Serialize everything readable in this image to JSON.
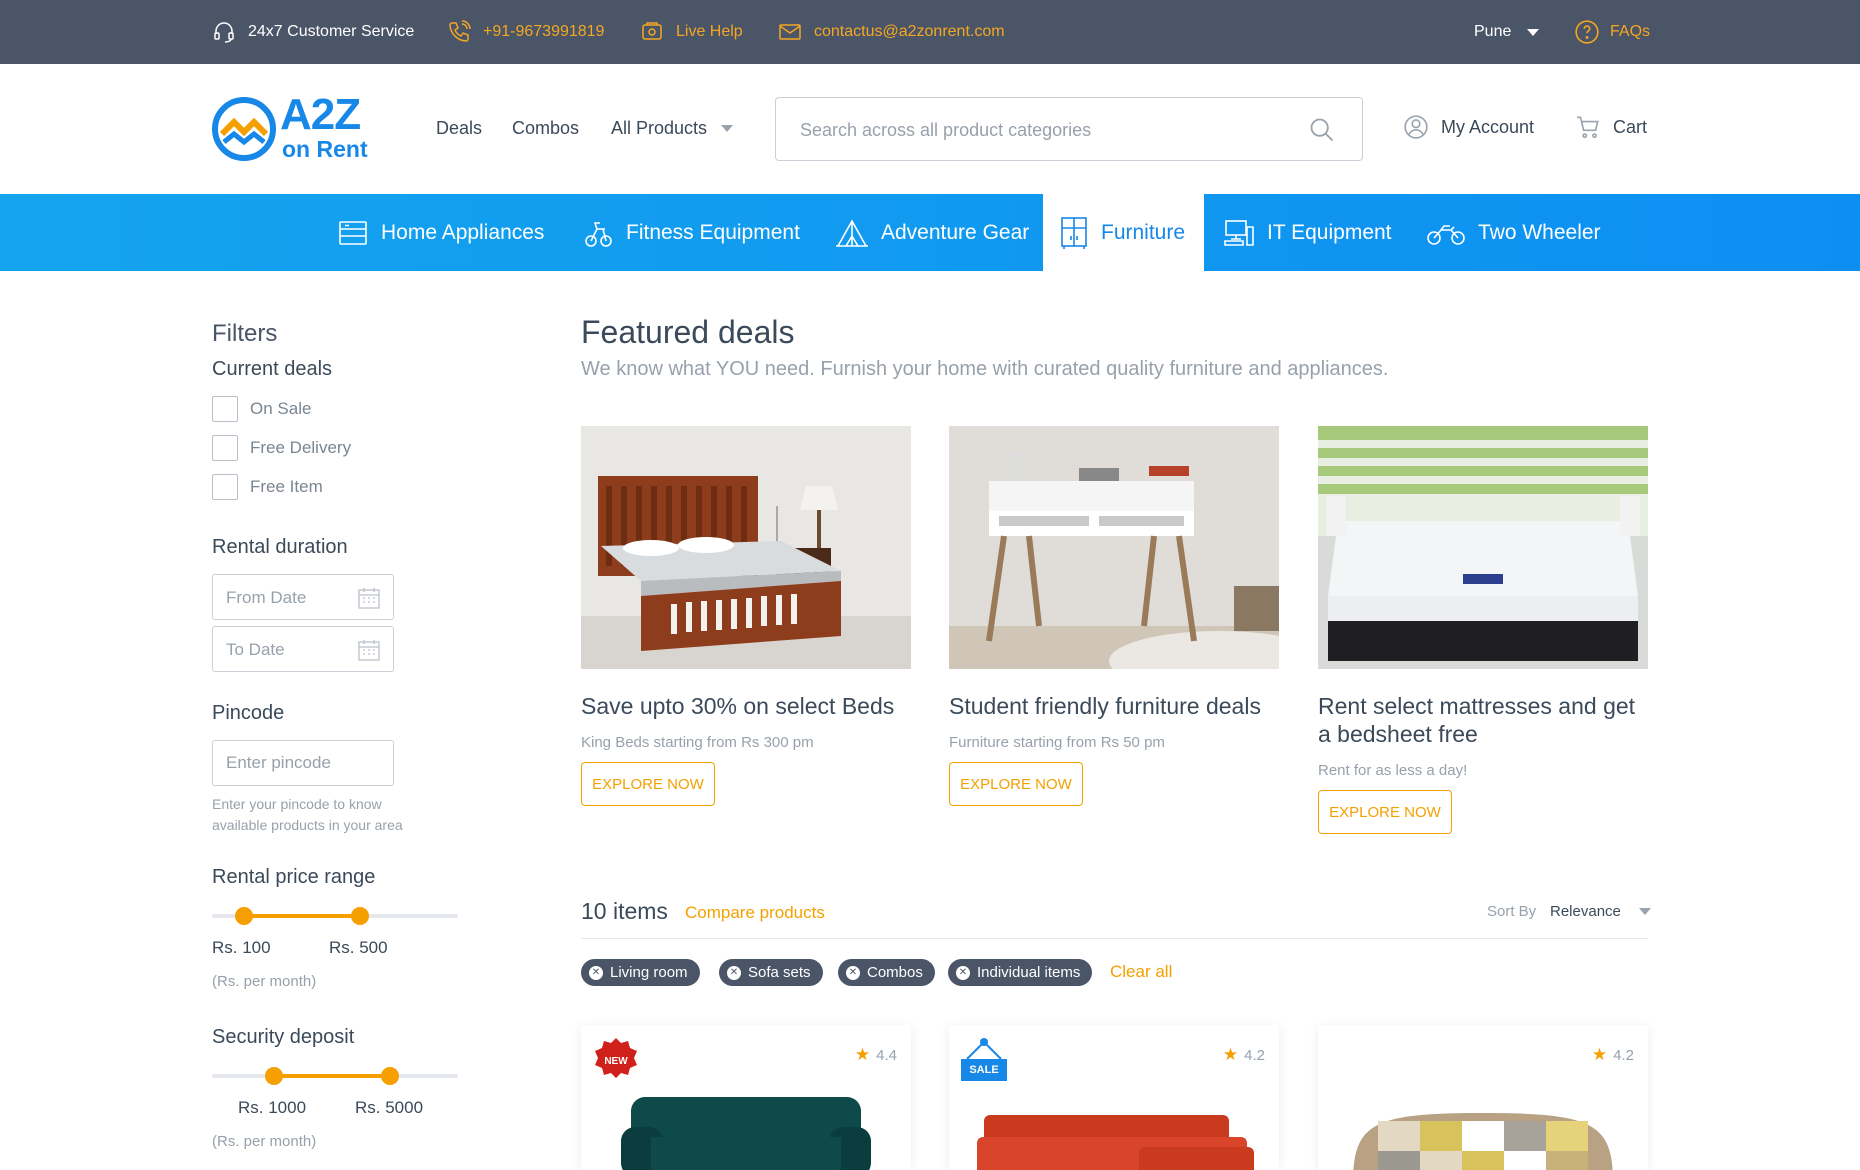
{
  "topbar": {
    "service": "24x7 Customer Service",
    "phone": "+91-9673991819",
    "live_help": "Live Help",
    "email": "contactus@a2zonrent.com",
    "city": "Pune",
    "faqs": "FAQs"
  },
  "header": {
    "logo_main": "A2Z",
    "logo_sub": "on Rent",
    "nav": [
      "Deals",
      "Combos",
      "All Products"
    ],
    "search_placeholder": "Search across all product categories",
    "account": "My Account",
    "cart": "Cart"
  },
  "categories": [
    {
      "label": "Home Appliances",
      "icon": "appliance-icon"
    },
    {
      "label": "Fitness Equipment",
      "icon": "exercise-bike-icon"
    },
    {
      "label": "Adventure Gear",
      "icon": "tent-icon"
    },
    {
      "label": "Furniture",
      "icon": "wardrobe-icon",
      "active": true
    },
    {
      "label": "IT Equipment",
      "icon": "computer-icon"
    },
    {
      "label": "Two Wheeler",
      "icon": "motorcycle-icon"
    }
  ],
  "filters": {
    "title": "Filters",
    "current_deals": "Current deals",
    "deals": [
      "On Sale",
      "Free Delivery",
      "Free Item"
    ],
    "rental_duration": "Rental duration",
    "from_date": "From Date",
    "to_date": "To Date",
    "pincode": "Pincode",
    "pincode_placeholder": "Enter pincode",
    "pincode_hint": "Enter your pincode to know available products in your area",
    "price_range": "Rental price range",
    "price_min": "Rs. 100",
    "price_max": "Rs. 500",
    "price_unit": "(Rs. per month)",
    "deposit": "Security deposit",
    "deposit_min": "Rs. 1000",
    "deposit_max": "Rs. 5000",
    "deposit_unit": "(Rs. per month)"
  },
  "featured": {
    "title": "Featured deals",
    "subtitle": "We know what YOU need. Furnish your home with curated quality furniture and appliances.",
    "cards": [
      {
        "title": "Save upto 30% on select  Beds",
        "sub": "King Beds starting from Rs 300 pm",
        "button": "EXPLORE NOW"
      },
      {
        "title": "Student friendly furniture deals",
        "sub": "Furniture starting from Rs 50 pm",
        "button": "EXPLORE NOW"
      },
      {
        "title": "Rent select mattresses and get a bedsheet free",
        "sub": "Rent for as less a day!",
        "button": "EXPLORE NOW"
      }
    ]
  },
  "listing": {
    "count": "10 items",
    "compare": "Compare products",
    "sort_label": "Sort By",
    "sort_value": "Relevance",
    "chips": [
      "Living room",
      "Sofa sets",
      "Combos",
      "Individual items"
    ],
    "clear": "Clear all",
    "products": [
      {
        "badge": "NEW",
        "rating": "4.4"
      },
      {
        "badge": "SALE",
        "rating": "4.2"
      },
      {
        "badge": "",
        "rating": "4.2"
      }
    ]
  },
  "colors": {
    "topbar": "#4a5567",
    "accent": "#f5a000",
    "category_bar": "#14a4ee",
    "active_category": "#1787e8"
  }
}
